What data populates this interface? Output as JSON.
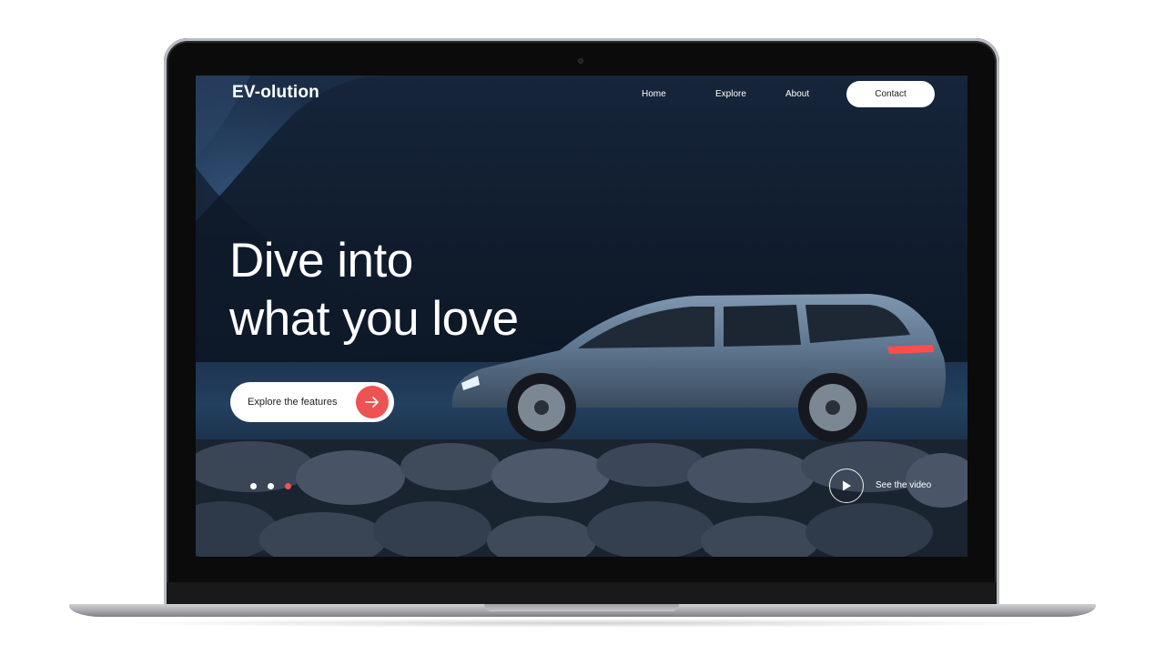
{
  "site": {
    "logo": "EV-olution",
    "nav": {
      "home": "Home",
      "explore": "Explore",
      "about": "About",
      "contact": "Contact"
    },
    "hero": {
      "headline_line1": "Dive into",
      "headline_line2": "what you love",
      "cta_label": "Explore the features",
      "cta_icon": "arrow-right-icon",
      "video_label": "See the video",
      "video_icon": "play-icon"
    },
    "carousel": {
      "slides": 3,
      "active_index": 2,
      "active_color": "#ee5253",
      "inactive_color": "#ffffff"
    }
  },
  "colors": {
    "accent": "#ee5253",
    "text_light": "#ffffff",
    "button_bg": "#ffffff"
  }
}
